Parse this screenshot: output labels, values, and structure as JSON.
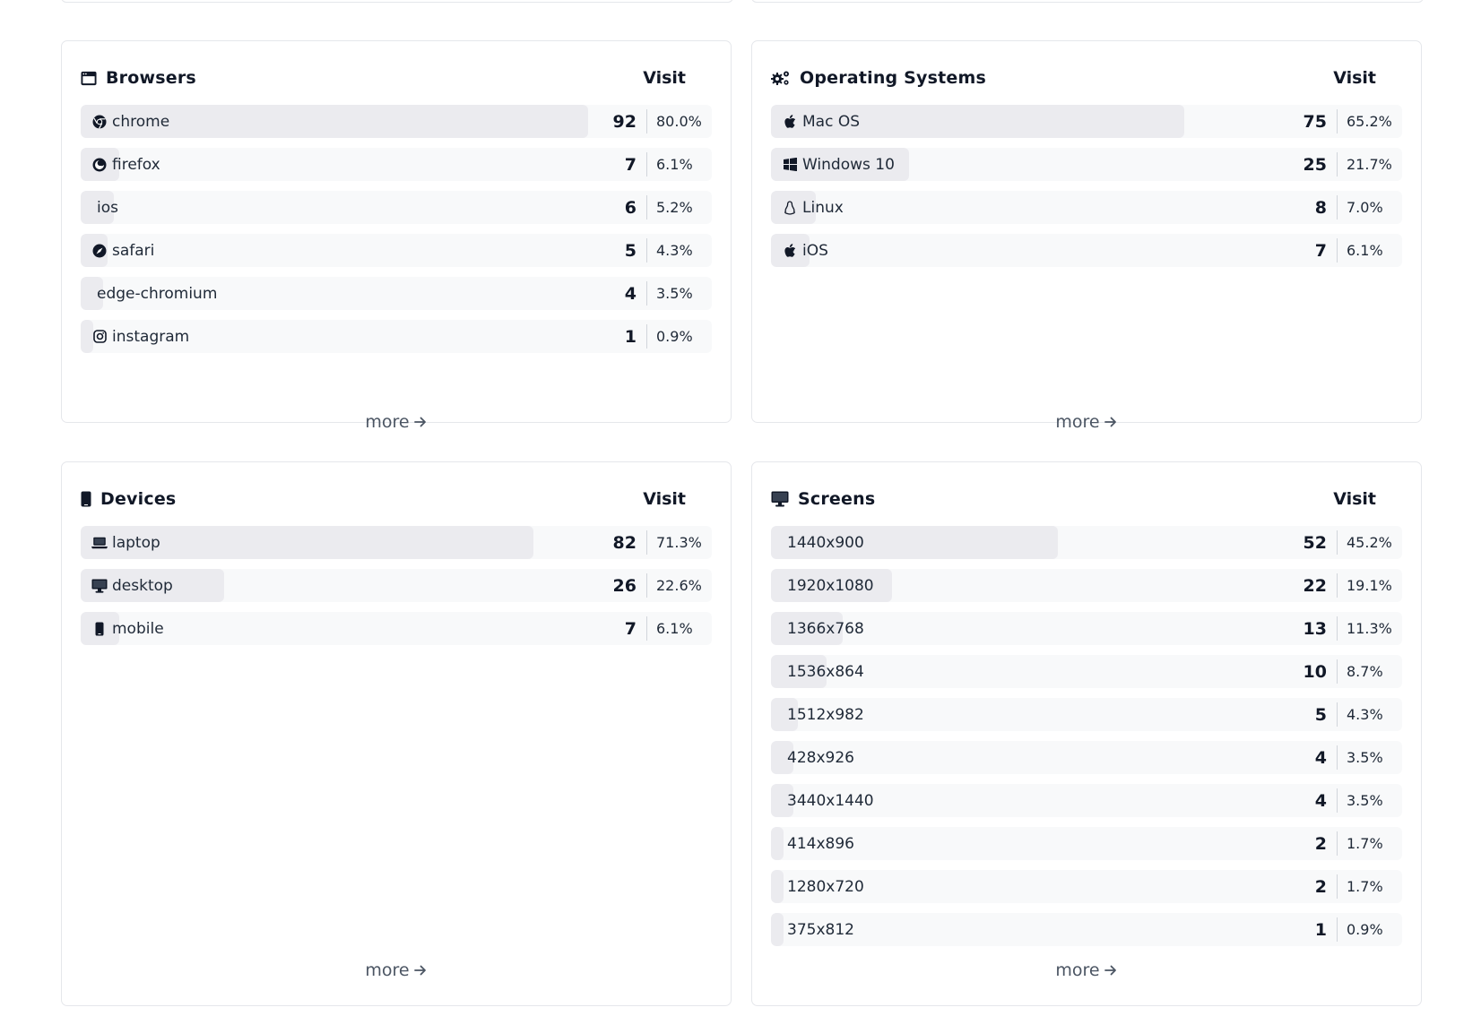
{
  "panels": {
    "browsers": {
      "title": "Browsers",
      "metric": "Visit",
      "more_label": "more",
      "rows": [
        {
          "label": "chrome",
          "icon": "chrome-icon",
          "count": "92",
          "percent": "80.0%",
          "share": 0.8
        },
        {
          "label": "firefox",
          "icon": "firefox-icon",
          "count": "7",
          "percent": "6.1%",
          "share": 0.061
        },
        {
          "label": "ios",
          "icon": "",
          "count": "6",
          "percent": "5.2%",
          "share": 0.052
        },
        {
          "label": "safari",
          "icon": "safari-icon",
          "count": "5",
          "percent": "4.3%",
          "share": 0.043
        },
        {
          "label": "edge-chromium",
          "icon": "",
          "count": "4",
          "percent": "3.5%",
          "share": 0.035
        },
        {
          "label": "instagram",
          "icon": "instagram-icon",
          "count": "1",
          "percent": "0.9%",
          "share": 0.009
        }
      ]
    },
    "os": {
      "title": "Operating Systems",
      "metric": "Visit",
      "more_label": "more",
      "rows": [
        {
          "label": "Mac OS",
          "icon": "apple-icon",
          "count": "75",
          "percent": "65.2%",
          "share": 0.652
        },
        {
          "label": "Windows 10",
          "icon": "windows-icon",
          "count": "25",
          "percent": "21.7%",
          "share": 0.217
        },
        {
          "label": "Linux",
          "icon": "linux-icon",
          "count": "8",
          "percent": "7.0%",
          "share": 0.07
        },
        {
          "label": "iOS",
          "icon": "apple-icon",
          "count": "7",
          "percent": "6.1%",
          "share": 0.061
        }
      ]
    },
    "devices": {
      "title": "Devices",
      "metric": "Visit",
      "more_label": "more",
      "rows": [
        {
          "label": "laptop",
          "icon": "laptop-icon",
          "count": "82",
          "percent": "71.3%",
          "share": 0.713
        },
        {
          "label": "desktop",
          "icon": "desktop-icon",
          "count": "26",
          "percent": "22.6%",
          "share": 0.226
        },
        {
          "label": "mobile",
          "icon": "mobile-icon",
          "count": "7",
          "percent": "6.1%",
          "share": 0.061
        }
      ]
    },
    "screens": {
      "title": "Screens",
      "metric": "Visit",
      "more_label": "more",
      "rows": [
        {
          "label": "1440x900",
          "icon": "",
          "count": "52",
          "percent": "45.2%",
          "share": 0.452
        },
        {
          "label": "1920x1080",
          "icon": "",
          "count": "22",
          "percent": "19.1%",
          "share": 0.191
        },
        {
          "label": "1366x768",
          "icon": "",
          "count": "13",
          "percent": "11.3%",
          "share": 0.113
        },
        {
          "label": "1536x864",
          "icon": "",
          "count": "10",
          "percent": "8.7%",
          "share": 0.087
        },
        {
          "label": "1512x982",
          "icon": "",
          "count": "5",
          "percent": "4.3%",
          "share": 0.043
        },
        {
          "label": "428x926",
          "icon": "",
          "count": "4",
          "percent": "3.5%",
          "share": 0.035
        },
        {
          "label": "3440x1440",
          "icon": "",
          "count": "4",
          "percent": "3.5%",
          "share": 0.035
        },
        {
          "label": "414x896",
          "icon": "",
          "count": "2",
          "percent": "1.7%",
          "share": 0.017
        },
        {
          "label": "1280x720",
          "icon": "",
          "count": "2",
          "percent": "1.7%",
          "share": 0.017
        },
        {
          "label": "375x812",
          "icon": "",
          "count": "1",
          "percent": "0.9%",
          "share": 0.009
        }
      ]
    }
  }
}
